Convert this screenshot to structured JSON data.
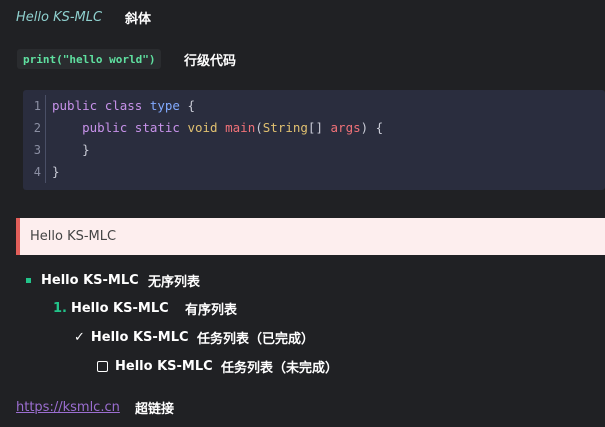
{
  "italic": {
    "text": "Hello KS-MLC",
    "desc": "斜体"
  },
  "inline_code": {
    "code": "print(\"hello world\")",
    "desc": "行级代码"
  },
  "code_block": {
    "line_numbers": [
      "1",
      "2",
      "3",
      "4"
    ]
  },
  "blockquote": {
    "text": "Hello KS-MLC"
  },
  "unordered": {
    "text": "Hello KS-MLC",
    "desc": "无序列表"
  },
  "ordered": {
    "number": "1.",
    "text": "Hello KS-MLC",
    "desc": "有序列表"
  },
  "task_done": {
    "mark": "✓",
    "text": "Hello KS-MLC",
    "desc": "任务列表（已完成）"
  },
  "task_todo": {
    "text": "Hello KS-MLC",
    "desc": "任务列表（未完成）"
  },
  "link": {
    "text": "https://ksmlc.cn",
    "desc": "超链接"
  },
  "colors": {
    "background": "#202124",
    "accent_green": "#22c48a",
    "quote_border": "#e25f5a",
    "link": "#9b6ed1"
  }
}
